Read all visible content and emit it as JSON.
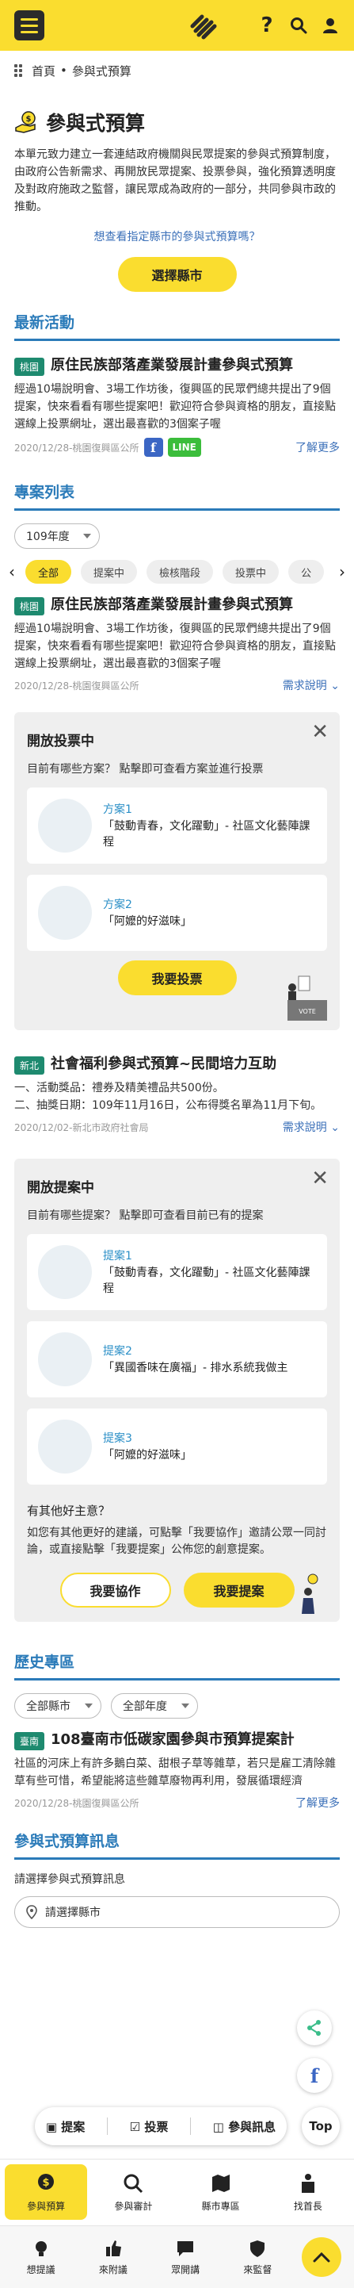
{
  "header": {
    "logo": "hand-logo",
    "help": "?"
  },
  "breadcrumb": {
    "home": "首頁",
    "sep": "•",
    "current": "參與式預算"
  },
  "page": {
    "title": "參與式預算",
    "intro": "本單元致力建立一套連結政府機關與民眾提案的參與式預算制度，由政府公告新需求、再開放民眾提案、投票參與，強化預算透明度及對政府施政之監督，讓民眾成為政府的一部分，共同參與市政的推動。",
    "designated_link": "想查看指定縣市的參與式預算嗎？",
    "select_city_btn": "選擇縣市"
  },
  "latest": {
    "heading": "最新活動",
    "card": {
      "badge": "桃園",
      "title": "原住民族部落產業發展計畫參與式預算",
      "desc": "經過10場說明會、3場工作坊後，復興區的民眾們總共提出了9個提案，快來看看有哪些提案吧！歡迎符合參與資格的朋友，直接點選線上投票網址，選出最喜歡的3個案子喔",
      "date": "2020/12/28-桃園復興區公所",
      "share_fb": "f",
      "share_line": "LINE",
      "more": "了解更多"
    }
  },
  "projects": {
    "heading": "專案列表",
    "year_select": "109年度",
    "filters": [
      "全部",
      "提案中",
      "檢核階段",
      "投票中",
      "公"
    ],
    "active_filter": "全部",
    "card1": {
      "badge": "桃園",
      "title": "原住民族部落產業發展計畫參與式預算",
      "desc": "經過10場說明會、3場工作坊後，復興區的民眾們總共提出了9個提案，快來看看有哪些提案吧！歡迎符合參與資格的朋友，直接點選線上投票網址，選出最喜歡的3個案子喔",
      "date": "2020/12/28-桃園復興區公所",
      "more": "需求說明"
    },
    "vote_box": {
      "heading": "開放投票中",
      "sub": "目前有哪些方案？ 點擊即可查看方案並進行投票",
      "options": [
        {
          "label": "方案1",
          "title": "「鼓動青春，文化躍動」- 社區文化藝陣課程"
        },
        {
          "label": "方案2",
          "title": "「阿嬤的好滋味」"
        }
      ],
      "button": "我要投票",
      "box_label": "VOTE"
    },
    "card2": {
      "badge": "新北",
      "title": "社會福利參與式預算~民間培力互助",
      "desc": "一、活動獎品：禮券及精美禮品共500份。\n二、抽獎日期：109年11月16日，公布得獎名單為11月下旬。",
      "date": "2020/12/02-新北市政府社會局",
      "more": "需求說明"
    },
    "proposal_box": {
      "heading": "開放提案中",
      "sub": "目前有哪些提案？ 點擊即可查看目前已有的提案",
      "options": [
        {
          "label": "提案1",
          "title": "「鼓動青春，文化躍動」- 社區文化藝陣課程"
        },
        {
          "label": "提案2",
          "title": "「異國香味在廣福」- 排水系統我做主"
        },
        {
          "label": "提案3",
          "title": "「阿嬤的好滋味」"
        }
      ],
      "idea_heading": "有其他好主意？",
      "idea_text": "如您有其他更好的建議，可點擊「我要協作」邀請公眾一同討論，或直接點擊「我要提案」公佈您的創意提案。",
      "btn_collab": "我要協作",
      "btn_propose": "我要提案"
    }
  },
  "history": {
    "heading": "歷史專區",
    "select_city": "全部縣市",
    "select_year": "全部年度",
    "card": {
      "badge": "臺南",
      "title": "108臺南市低碳家園參與市預算提案計",
      "desc": "社區的河床上有許多鵝白菜、甜根子草等雜草，若只是雇工清除雜草有些可惜，希望能將這些雜草廢物再利用，發展循環經濟",
      "date": "2020/12/28-桃園復興區公所",
      "more": "了解更多"
    }
  },
  "info": {
    "heading": "參與式預算訊息",
    "label": "請選擇參與式預算訊息",
    "placeholder": "請選擇縣市"
  },
  "actions": {
    "propose": "提案",
    "vote": "投票",
    "info": "參與訊息",
    "top": "Top"
  },
  "tabs": [
    {
      "label": "參與預算",
      "icon": "dollar-icon"
    },
    {
      "label": "參與審計",
      "icon": "magnifier-icon"
    },
    {
      "label": "縣市專區",
      "icon": "map-icon"
    },
    {
      "label": "找首長",
      "icon": "podium-icon"
    }
  ],
  "tabs2": [
    {
      "label": "想提議",
      "icon": "bulb-icon"
    },
    {
      "label": "來附議",
      "icon": "thumb-icon"
    },
    {
      "label": "眾開講",
      "icon": "chat-icon"
    },
    {
      "label": "來監督",
      "icon": "shield-icon"
    }
  ],
  "colors": {
    "brand_yellow": "#fadd2f",
    "section_blue": "#2b7bb9",
    "badge_green": "#1e8a6f"
  }
}
